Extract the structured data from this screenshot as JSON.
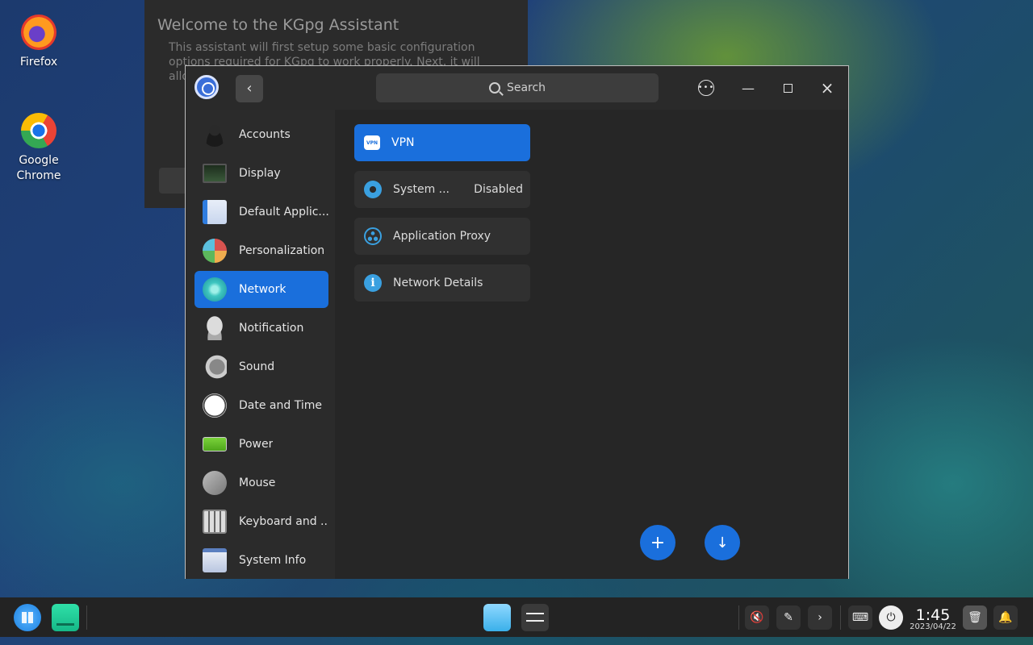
{
  "desktop": {
    "icons": [
      {
        "label": "Firefox",
        "icon": "firefox-icon"
      },
      {
        "label": "Google Chrome",
        "icon": "chrome-icon"
      }
    ]
  },
  "background_dialog": {
    "title": "Welcome to the KGpg Assistant",
    "text": "This assistant will first setup some basic configuration options required for KGpg to work properly. Next, it will allow you to cre... em..."
  },
  "window": {
    "search_placeholder": "Search",
    "sidebar": {
      "items": [
        {
          "label": "Accounts",
          "icon": "accounts-icon"
        },
        {
          "label": "Display",
          "icon": "display-icon"
        },
        {
          "label": "Default Applic...",
          "icon": "default-applications-icon"
        },
        {
          "label": "Personalization",
          "icon": "personalization-icon"
        },
        {
          "label": "Network",
          "icon": "network-icon",
          "active": true
        },
        {
          "label": "Notification",
          "icon": "notification-bell-icon"
        },
        {
          "label": "Sound",
          "icon": "sound-icon"
        },
        {
          "label": "Date and Time",
          "icon": "clock-icon"
        },
        {
          "label": "Power",
          "icon": "battery-icon"
        },
        {
          "label": "Mouse",
          "icon": "mouse-icon"
        },
        {
          "label": "Keyboard and ...",
          "icon": "keyboard-icon"
        },
        {
          "label": "System Info",
          "icon": "system-info-icon"
        }
      ]
    },
    "network_items": [
      {
        "label": "VPN",
        "icon": "vpn-icon",
        "icon_text": "VPN",
        "active": true,
        "value": ""
      },
      {
        "label": "System ...",
        "icon": "system-proxy-icon",
        "value": "Disabled"
      },
      {
        "label": "Application Proxy",
        "icon": "application-proxy-icon",
        "value": ""
      },
      {
        "label": "Network Details",
        "icon": "info-icon",
        "value": ""
      }
    ],
    "add_button": "+",
    "import_button": "↓"
  },
  "taskbar": {
    "time": "1:45",
    "date": "2023/04/22"
  },
  "colors": {
    "accent": "#1a6fdc"
  }
}
